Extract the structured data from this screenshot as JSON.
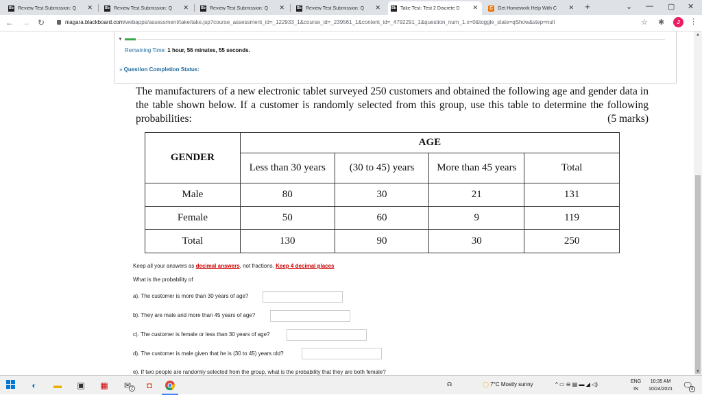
{
  "browser": {
    "tabs": [
      {
        "label": "Review Test Submission: Q",
        "icon": "blackboard-icon",
        "fav": "Bb"
      },
      {
        "label": "Review Test Submission: Q",
        "icon": "blackboard-icon",
        "fav": "Bb"
      },
      {
        "label": "Review Test Submission: Q",
        "icon": "blackboard-icon",
        "fav": "Bb"
      },
      {
        "label": "Review Test Submission: Q",
        "icon": "blackboard-icon",
        "fav": "Bb"
      },
      {
        "label": "Take Test: Test 2 Discrete D",
        "icon": "blackboard-icon",
        "fav": "Bb",
        "active": true
      },
      {
        "label": "Get Homework Help With C",
        "icon": "chegg-icon",
        "fav": "C"
      }
    ],
    "url_domain": "niagara.blackboard.com",
    "url_path": "/webapps/assessment/take/take.jsp?course_assessment_id=_122933_1&course_id=_239561_1&content_id=_4792291_1&question_num_1.x=0&toggle_state=qShow&step=null",
    "profile_initial": "J"
  },
  "test": {
    "remaining_label": "Remaining Time:",
    "remaining_value": "1 hour, 56 minutes, 55 seconds.",
    "completion_status": "Question Completion Status:"
  },
  "question": {
    "text": "The manufacturers of a new electronic tablet surveyed 250 customers and obtained the following age and gender data in the table shown below.  If a customer is randomly selected from this group, use this table to determine the following probabilities:",
    "marks": "(5 marks)",
    "table": {
      "gender_header": "GENDER",
      "age_header": "AGE",
      "col1": "Less than 30 years",
      "col2": "(30 to 45) years",
      "col3": "More than 45 years",
      "total_header": "Total",
      "rows": [
        {
          "label": "Male",
          "v1": "80",
          "v2": "30",
          "v3": "21",
          "total": "131"
        },
        {
          "label": "Female",
          "v1": "50",
          "v2": "60",
          "v3": "9",
          "total": "119"
        },
        {
          "label": "Total",
          "v1": "130",
          "v2": "90",
          "v3": "30",
          "total": "250"
        }
      ]
    },
    "instructions_prefix": "Keep all your answers as ",
    "instructions_decimal": "decimal answers",
    "instructions_mid": ", not fractions. ",
    "instructions_places": "Keep 4 decimal places",
    "what_is": "What is the probability of",
    "parts": [
      "a). The customer is more than 30 years of age?",
      "b). They are male and more than 45 years of age?",
      "c). The customer is female or less than 30 years of age?",
      "d). The customer is male given that he is (30 to 45) years old?",
      "e). If two people are randomly selected from the group, what is the probability that they are both female?"
    ]
  },
  "taskbar": {
    "weather": "7°C  Mostly sunny",
    "lang_top": "ENG",
    "lang_bottom": "IN",
    "time": "10:35 AM",
    "date": "10/24/2021",
    "notification_count": "4",
    "chrome_badge": "2"
  }
}
